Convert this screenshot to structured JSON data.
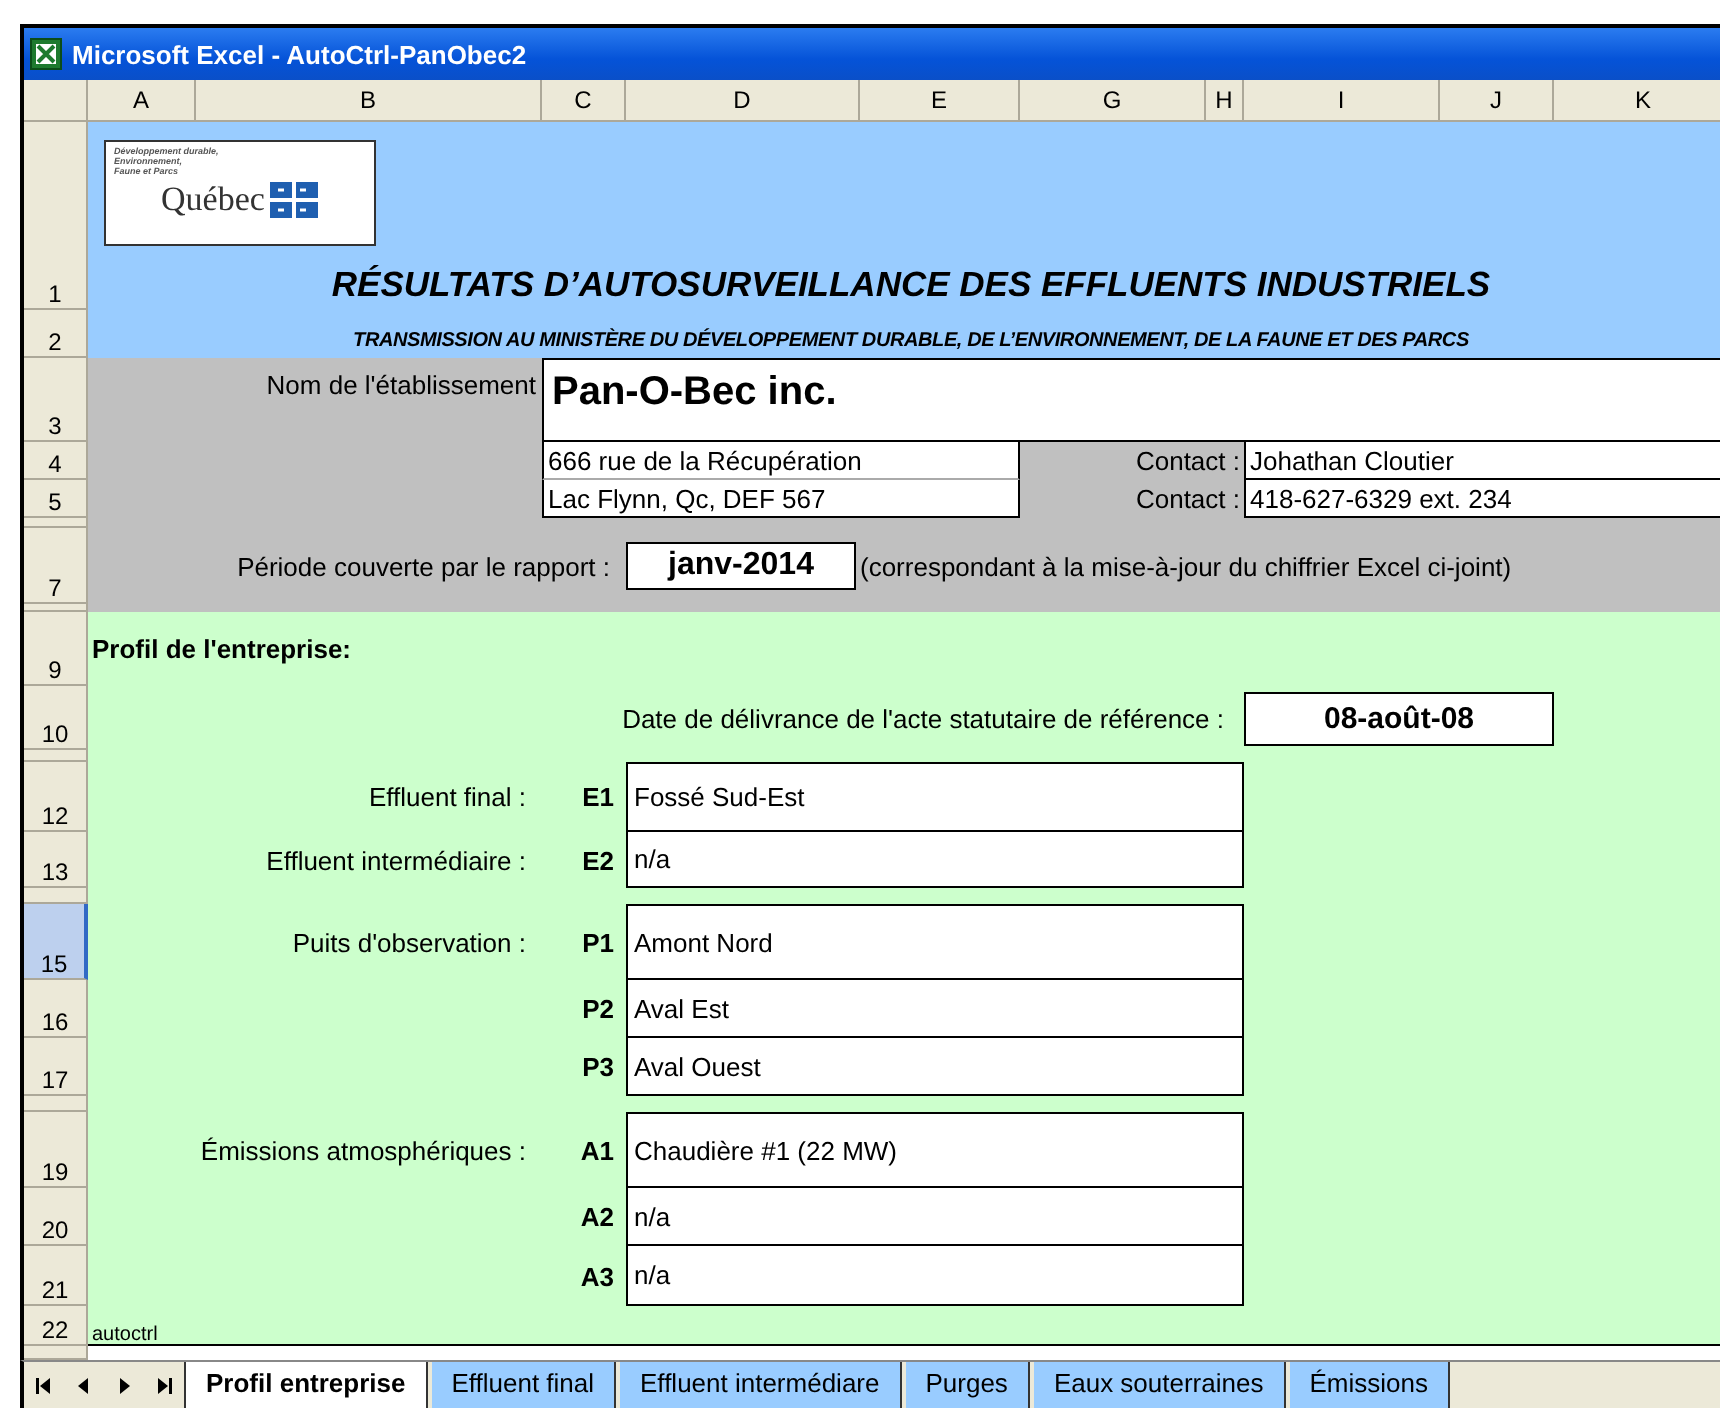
{
  "window": {
    "title": "Microsoft Excel - AutoCtrl-PanObec2"
  },
  "columns": [
    "A",
    "B",
    "C",
    "D",
    "E",
    "G",
    "H",
    "I",
    "J",
    "K"
  ],
  "rows": [
    {
      "label": "1",
      "selected": false
    },
    {
      "label": "2",
      "selected": false
    },
    {
      "label": "3",
      "selected": false
    },
    {
      "label": "4",
      "selected": false
    },
    {
      "label": "5",
      "selected": false
    },
    {
      "selected": false
    },
    {
      "label": "7",
      "selected": false
    },
    {
      "selected": false
    },
    {
      "label": "9",
      "selected": false
    },
    {
      "label": "10",
      "selected": false
    },
    {
      "selected": false
    },
    {
      "label": "12",
      "selected": false
    },
    {
      "label": "13",
      "selected": false
    },
    {
      "selected": false
    },
    {
      "label": "15",
      "selected": true
    },
    {
      "label": "16",
      "selected": false
    },
    {
      "label": "17",
      "selected": false
    },
    {
      "selected": false
    },
    {
      "label": "19",
      "selected": false
    },
    {
      "label": "20",
      "selected": false
    },
    {
      "label": "21",
      "selected": false
    },
    {
      "label": "22",
      "selected": false
    },
    {
      "selected": false
    }
  ],
  "logo": {
    "ministry": [
      "Développement durable,",
      "Environnement,",
      "Faune et Parcs"
    ],
    "name": "Québec"
  },
  "heading": {
    "title": "RÉSULTATS D’AUTOSURVEILLANCE DES EFFLUENTS INDUSTRIELS",
    "subtitle": "TRANSMISSION AU MINISTÈRE DU DÉVELOPPEMENT DURABLE, DE L’ENVIRONNEMENT, DE LA FAUNE ET DES PARCS"
  },
  "establishment": {
    "label": "Nom de l'établissement",
    "name": "Pan-O-Bec inc.",
    "address": [
      "666 rue de la Récupération",
      "Lac Flynn, Qc, DEF 567"
    ],
    "contacts": [
      {
        "label": "Contact :",
        "value": "Johathan Cloutier"
      },
      {
        "label": "Contact :",
        "value": "418-627-6329 ext. 234"
      }
    ]
  },
  "period": {
    "label": "Période couverte par le rapport :",
    "value": "janv-2014",
    "note": "(correspondant à la mise-à-jour du chiffrier Excel ci-joint)"
  },
  "profile": {
    "title": "Profil de l'entreprise:",
    "date_label": "Date de délivrance de l'acte statutaire de référence :",
    "date": "08-août-08",
    "fields": [
      {
        "label": "Effluent final :",
        "code": "E1",
        "value": "Fossé Sud-Est"
      },
      {
        "label": "Effluent intermédiaire :",
        "code": "E2",
        "value": "n/a"
      },
      {
        "label": "Puits d'observation :",
        "code": "P1",
        "value": "Amont Nord"
      },
      {
        "code": "P2",
        "value": "Aval Est"
      },
      {
        "code": "P3",
        "value": "Aval Ouest"
      },
      {
        "label": "Émissions atmosphériques :",
        "code": "A1",
        "value": "Chaudière #1 (22 MW)"
      },
      {
        "code": "A2",
        "value": "n/a"
      },
      {
        "code": "A3",
        "value": "n/a"
      }
    ]
  },
  "footer_note": "autoctrl",
  "sheet_tabs": [
    {
      "label": "Profil entreprise",
      "selected": true
    },
    {
      "label": "Effluent final",
      "selected": false
    },
    {
      "label": "Effluent intermédiare",
      "selected": false
    },
    {
      "label": "Purges",
      "selected": false
    },
    {
      "label": "Eaux souterraines",
      "selected": false
    },
    {
      "label": "Émissions",
      "selected": false
    }
  ]
}
